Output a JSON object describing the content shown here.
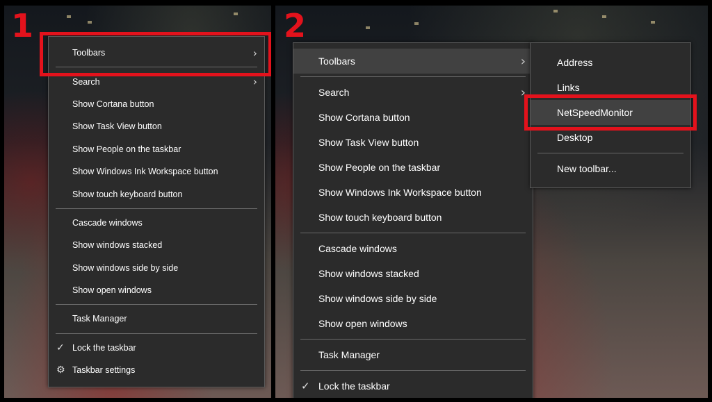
{
  "panels": [
    {
      "step": "1",
      "menu": {
        "items": [
          {
            "label": "Toolbars",
            "submenu": true
          },
          {
            "label": "Search",
            "submenu": true
          },
          {
            "label": "Show Cortana button"
          },
          {
            "label": "Show Task View button"
          },
          {
            "label": "Show People on the taskbar"
          },
          {
            "label": "Show Windows Ink Workspace button"
          },
          {
            "label": "Show touch keyboard button"
          },
          {
            "label": "Cascade windows"
          },
          {
            "label": "Show windows stacked"
          },
          {
            "label": "Show windows side by side"
          },
          {
            "label": "Show open windows"
          },
          {
            "label": "Task Manager"
          },
          {
            "label": "Lock the taskbar",
            "checked": true
          },
          {
            "label": "Taskbar settings",
            "icon": "gear-icon"
          }
        ]
      }
    },
    {
      "step": "2",
      "menu": {
        "items": [
          {
            "label": "Toolbars",
            "submenu": true,
            "active": true
          },
          {
            "label": "Search",
            "submenu": true
          },
          {
            "label": "Show Cortana button"
          },
          {
            "label": "Show Task View button"
          },
          {
            "label": "Show People on the taskbar"
          },
          {
            "label": "Show Windows Ink Workspace button"
          },
          {
            "label": "Show touch keyboard button"
          },
          {
            "label": "Cascade windows"
          },
          {
            "label": "Show windows stacked"
          },
          {
            "label": "Show windows side by side"
          },
          {
            "label": "Show open windows"
          },
          {
            "label": "Task Manager"
          },
          {
            "label": "Lock the taskbar",
            "checked": true
          }
        ]
      },
      "submenu": {
        "items": [
          {
            "label": "Address"
          },
          {
            "label": "Links"
          },
          {
            "label": "NetSpeedMonitor",
            "hovered": true
          },
          {
            "label": "Desktop"
          },
          {
            "label": "New toolbar..."
          }
        ]
      }
    }
  ],
  "icons": {
    "chevron": "chevron-right-icon",
    "check": "checkmark-icon",
    "gear": "gear-icon"
  },
  "colors": {
    "menu_bg": "#2b2b2b",
    "highlight": "#e3121c",
    "hover_bg": "#414141"
  }
}
